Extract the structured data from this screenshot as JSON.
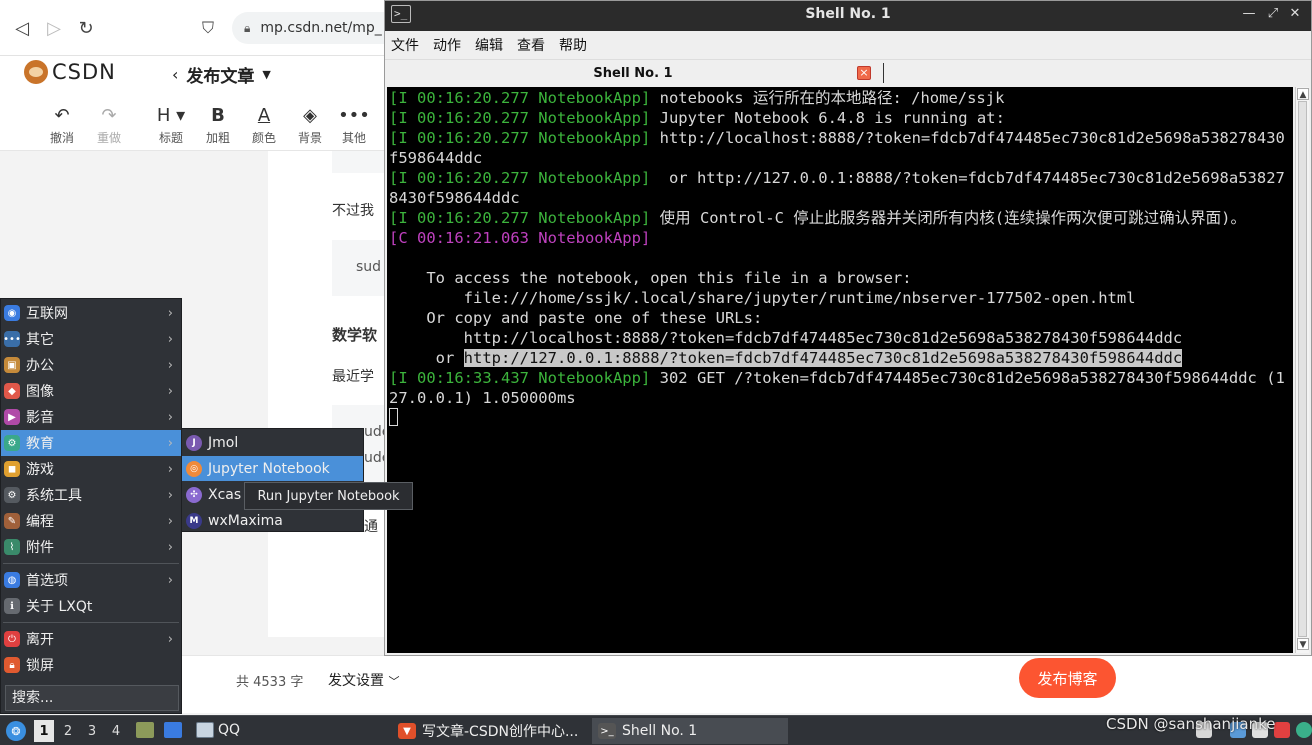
{
  "browser": {
    "url": "mp.csdn.net/mp_",
    "logo": "CSDN",
    "page_title": "发布文章",
    "toolbar": [
      {
        "icon": "undo-icon",
        "glyph": "↶",
        "label": "撤消",
        "enabled": true
      },
      {
        "icon": "redo-icon",
        "glyph": "↷",
        "label": "重做",
        "enabled": false
      },
      {
        "icon": "heading-icon",
        "glyph": "H ▾",
        "label": "标题",
        "enabled": true
      },
      {
        "icon": "bold-icon",
        "glyph": "B",
        "label": "加粗",
        "enabled": true
      },
      {
        "icon": "font-color-icon",
        "glyph": "A",
        "label": "颜色",
        "enabled": true
      },
      {
        "icon": "paint-bucket-icon",
        "glyph": "◈",
        "label": "背景",
        "enabled": true
      },
      {
        "icon": "more-icon",
        "glyph": "•••",
        "label": "其他",
        "enabled": true
      }
    ],
    "doc_fragments": {
      "p1": "不过我",
      "code1": "sud",
      "heading": "数学软",
      "p2": "最近学",
      "code2a": "ude",
      "code2b": "ude",
      "p3": "通"
    },
    "word_count": "共 4533 字",
    "post_settings": "发文设置",
    "publish_button": "发布博客"
  },
  "terminal": {
    "title": "Shell No. 1",
    "menu": [
      "文件",
      "动作",
      "编辑",
      "查看",
      "帮助"
    ],
    "tab_label": "Shell No. 1",
    "lines": [
      {
        "tag": "[I 00:16:20.277 NotebookApp]",
        "tag_type": "info",
        "text": " notebooks 运行所在的本地路径: /home/ssjk"
      },
      {
        "tag": "[I 00:16:20.277 NotebookApp]",
        "tag_type": "info",
        "text": " Jupyter Notebook 6.4.8 is running at:"
      },
      {
        "tag": "[I 00:16:20.277 NotebookApp]",
        "tag_type": "info",
        "text": " http://localhost:8888/?token=fdcb7df474485ec730c81d2e5698a538278430f598644ddc"
      },
      {
        "tag": "[I 00:16:20.277 NotebookApp]",
        "tag_type": "info",
        "text": "  or http://127.0.0.1:8888/?token=fdcb7df474485ec730c81d2e5698a538278430f598644ddc"
      },
      {
        "tag": "[I 00:16:20.277 NotebookApp]",
        "tag_type": "info",
        "text": " 使用 Control-C 停止此服务器并关闭所有内核(连续操作两次便可跳过确认界面)。"
      },
      {
        "tag": "[C 00:16:21.063 NotebookApp]",
        "tag_type": "critical",
        "text": ""
      },
      {
        "tag": "",
        "tag_type": "none",
        "text": ""
      },
      {
        "tag": "",
        "tag_type": "none",
        "text": "    To access the notebook, open this file in a browser:"
      },
      {
        "tag": "",
        "tag_type": "none",
        "text": "        file:///home/ssjk/.local/share/jupyter/runtime/nbserver-177502-open.html"
      },
      {
        "tag": "",
        "tag_type": "none",
        "text": "    Or copy and paste one of these URLs:"
      },
      {
        "tag": "",
        "tag_type": "none",
        "text": "        http://localhost:8888/?token=fdcb7df474485ec730c81d2e5698a538278430f598644ddc"
      }
    ],
    "selected_line": {
      "prefix": "     or ",
      "selected": "http://127.0.0.1:8888/?token=fdcb7df474485ec730c81d2e5698a538278430f598644ddc"
    },
    "last_line": {
      "tag": "[I 00:16:33.437 NotebookApp]",
      "text": " 302 GET /?token=fdcb7df474485ec730c81d2e5698a538278430f598644ddc (127.0.0.1) 1.050000ms"
    }
  },
  "app_menu": {
    "items": [
      {
        "name": "internet",
        "label": "互联网",
        "color": "#3a7be0",
        "submenu": true
      },
      {
        "name": "other",
        "label": "其它",
        "color": "#3a6ea8",
        "submenu": true
      },
      {
        "name": "office",
        "label": "办公",
        "color": "#c58a3a",
        "submenu": true
      },
      {
        "name": "graphics",
        "label": "图像",
        "color": "#e0584a",
        "submenu": true
      },
      {
        "name": "multimedia",
        "label": "影音",
        "color": "#b04aa8",
        "submenu": true
      },
      {
        "name": "education",
        "label": "教育",
        "color": "#3aa88a",
        "submenu": true,
        "active": true
      },
      {
        "name": "games",
        "label": "游戏",
        "color": "#e0a030",
        "submenu": true
      },
      {
        "name": "system-tools",
        "label": "系统工具",
        "color": "#555a60",
        "submenu": true
      },
      {
        "name": "development",
        "label": "编程",
        "color": "#a0603a",
        "submenu": true
      },
      {
        "name": "accessories",
        "label": "附件",
        "color": "#3a8a6a",
        "submenu": true
      }
    ],
    "items2": [
      {
        "name": "preferences",
        "label": "首选项",
        "color": "#3a7be0",
        "submenu": true
      },
      {
        "name": "about",
        "label": "关于 LXQt",
        "color": "#666a70",
        "submenu": false
      }
    ],
    "items3": [
      {
        "name": "leave",
        "label": "离开",
        "color": "#e04040",
        "submenu": true
      },
      {
        "name": "lock-screen",
        "label": "锁屏",
        "color": "#e05a30",
        "submenu": false
      }
    ],
    "search_placeholder": "搜索..."
  },
  "sub_menu": {
    "items": [
      {
        "name": "jmol",
        "label": "Jmol",
        "color": "#7a5ab0",
        "glyph": "J"
      },
      {
        "name": "jupyter-notebook",
        "label": "Jupyter Notebook",
        "color": "#f08a3a",
        "glyph": "◎",
        "active": true
      },
      {
        "name": "xcas",
        "label": "Xcas",
        "color": "#8a6ad0",
        "glyph": "✣"
      },
      {
        "name": "wxmaxima",
        "label": "wxMaxima",
        "color": "#3a3a8a",
        "glyph": "M"
      }
    ],
    "tooltip": "Run Jupyter Notebook"
  },
  "taskbar": {
    "workspaces": [
      "1",
      "2",
      "3",
      "4"
    ],
    "active_workspace": "1",
    "qq_label": "QQ",
    "tasks": [
      {
        "name": "browser-task",
        "label": "写文章-CSDN创作中心...",
        "color": "#e0502a"
      },
      {
        "name": "terminal-task",
        "label": "Shell No. 1",
        "color": "#555",
        "active": true
      }
    ],
    "watermark": "CSDN @sanshanjianke"
  }
}
